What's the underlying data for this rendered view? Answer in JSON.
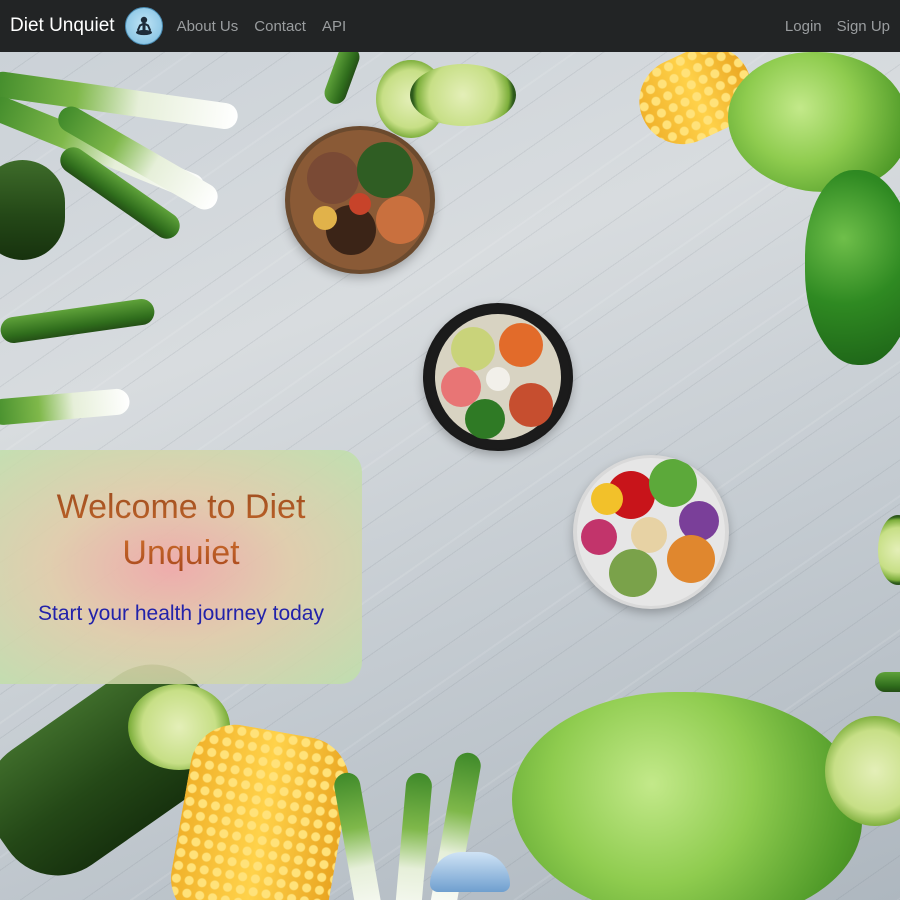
{
  "navbar": {
    "brand": "Diet Unquiet",
    "logo_icon": "meditation-logo-icon",
    "links": [
      "About Us",
      "Contact",
      "API"
    ],
    "right_links": [
      "Login",
      "Sign Up"
    ]
  },
  "hero": {
    "title": "Welcome to Diet Unquiet",
    "subtitle": "Start your health journey today"
  },
  "colors": {
    "navbar_bg": "#222425",
    "nav_link": "#9a9d9f",
    "title": "#b85a2a",
    "subtitle": "#2222aa"
  }
}
